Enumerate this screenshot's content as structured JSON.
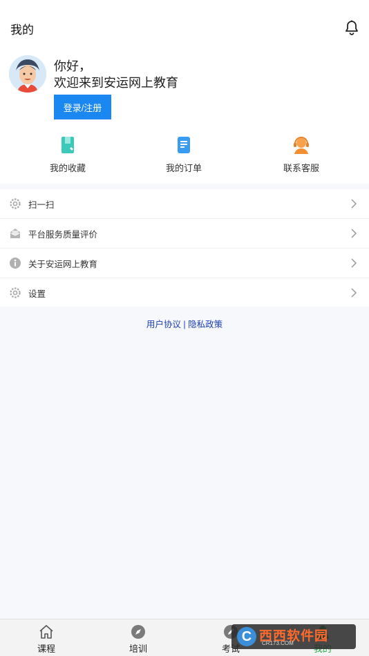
{
  "header": {
    "title": "我的"
  },
  "profile": {
    "greeting_line1": "你好，",
    "greeting_line2": "欢迎来到安运网上教育",
    "login_label": "登录/注册"
  },
  "quick_links": [
    {
      "label": "我的收藏",
      "icon": "bookmark-icon"
    },
    {
      "label": "我的订单",
      "icon": "document-icon"
    },
    {
      "label": "联系客服",
      "icon": "customer-service-icon"
    }
  ],
  "menu": [
    {
      "label": "扫一扫",
      "icon": "gear-icon"
    },
    {
      "label": "平台服务质量评价",
      "icon": "mail-icon"
    },
    {
      "label": "关于安运网上教育",
      "icon": "info-icon"
    },
    {
      "label": "设置",
      "icon": "gear-icon"
    }
  ],
  "links": {
    "agreement": "用户协议",
    "separator": " | ",
    "privacy": "隐私政策"
  },
  "tabbar": [
    {
      "label": "课程",
      "icon": "home-icon"
    },
    {
      "label": "培训",
      "icon": "compass-icon"
    },
    {
      "label": "考试",
      "icon": "pencil-icon"
    },
    {
      "label": "我的",
      "icon": "user-icon",
      "active": true
    }
  ],
  "watermark": {
    "brand": "西西软件园",
    "url": "CR173.COM"
  },
  "colors": {
    "primary": "#1b87f0",
    "active_tab": "#2aa84a",
    "link": "#1a3fb5"
  }
}
